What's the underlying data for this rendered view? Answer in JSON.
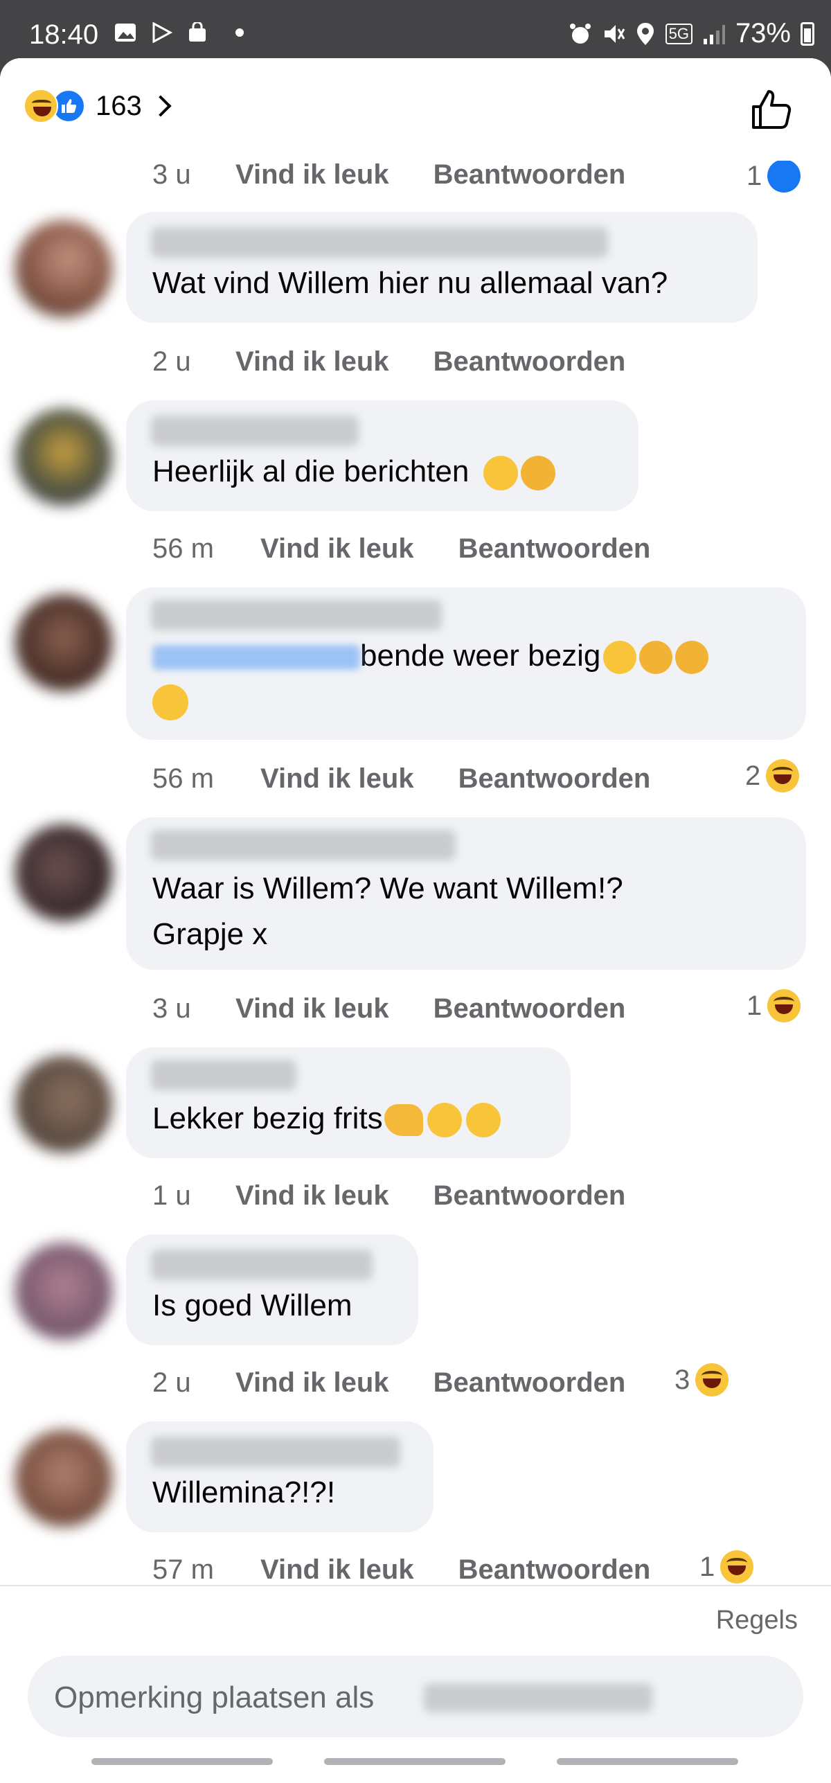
{
  "status_bar": {
    "time": "18:40",
    "battery": "73%",
    "network": "5G"
  },
  "header": {
    "reaction_count": "163",
    "reaction_icons": [
      "haha-emoji",
      "like-icon"
    ]
  },
  "comments": [
    {
      "text": "",
      "time": "3 u",
      "like_label": "Vind ik leuk",
      "reply_label": "Beantwoorden",
      "reaction_count": "1",
      "reaction_type": "like"
    },
    {
      "text": "Wat vind Willem hier nu allemaal van?",
      "time": "2 u",
      "like_label": "Vind ik leuk",
      "reply_label": "Beantwoorden"
    },
    {
      "text": "Heerlijk al die berichten",
      "emojis": [
        "face-with-tears-of-joy",
        "rolling-on-the-floor-laughing"
      ],
      "time": "56 m",
      "like_label": "Vind ik leuk",
      "reply_label": "Beantwoorden"
    },
    {
      "text": "bende weer bezig",
      "emojis": [
        "grinning-sweat",
        "rolling-on-the-floor-laughing",
        "rolling-on-the-floor-laughing",
        "face-with-hand-over-mouth"
      ],
      "time": "56 m",
      "like_label": "Vind ik leuk",
      "reply_label": "Beantwoorden",
      "reaction_count": "2",
      "reaction_type": "haha"
    },
    {
      "text_line1": "Waar is Willem? We want Willem!?",
      "text_line2": "Grapje x",
      "time": "3 u",
      "like_label": "Vind ik leuk",
      "reply_label": "Beantwoorden",
      "reaction_count": "1",
      "reaction_type": "haha"
    },
    {
      "text": "Lekker bezig frits",
      "emojis": [
        "flexed-biceps",
        "face-with-tears-of-joy",
        "face-with-tears-of-joy"
      ],
      "time": "1 u",
      "like_label": "Vind ik leuk",
      "reply_label": "Beantwoorden"
    },
    {
      "text": "Is goed Willem",
      "time": "2 u",
      "like_label": "Vind ik leuk",
      "reply_label": "Beantwoorden",
      "reaction_count": "3",
      "reaction_type": "haha"
    },
    {
      "text": "Willemina?!?!",
      "time": "57 m",
      "like_label": "Vind ik leuk",
      "reply_label": "Beantwoorden",
      "reaction_count": "1",
      "reaction_type": "haha"
    }
  ],
  "footer": {
    "rules_label": "Regels",
    "composer_placeholder": "Opmerking plaatsen als"
  },
  "colors": {
    "bubble": "#f0f2f5",
    "meta_text": "#65676b",
    "like_blue": "#1877f2",
    "haha_yellow": "#f7c43a"
  }
}
